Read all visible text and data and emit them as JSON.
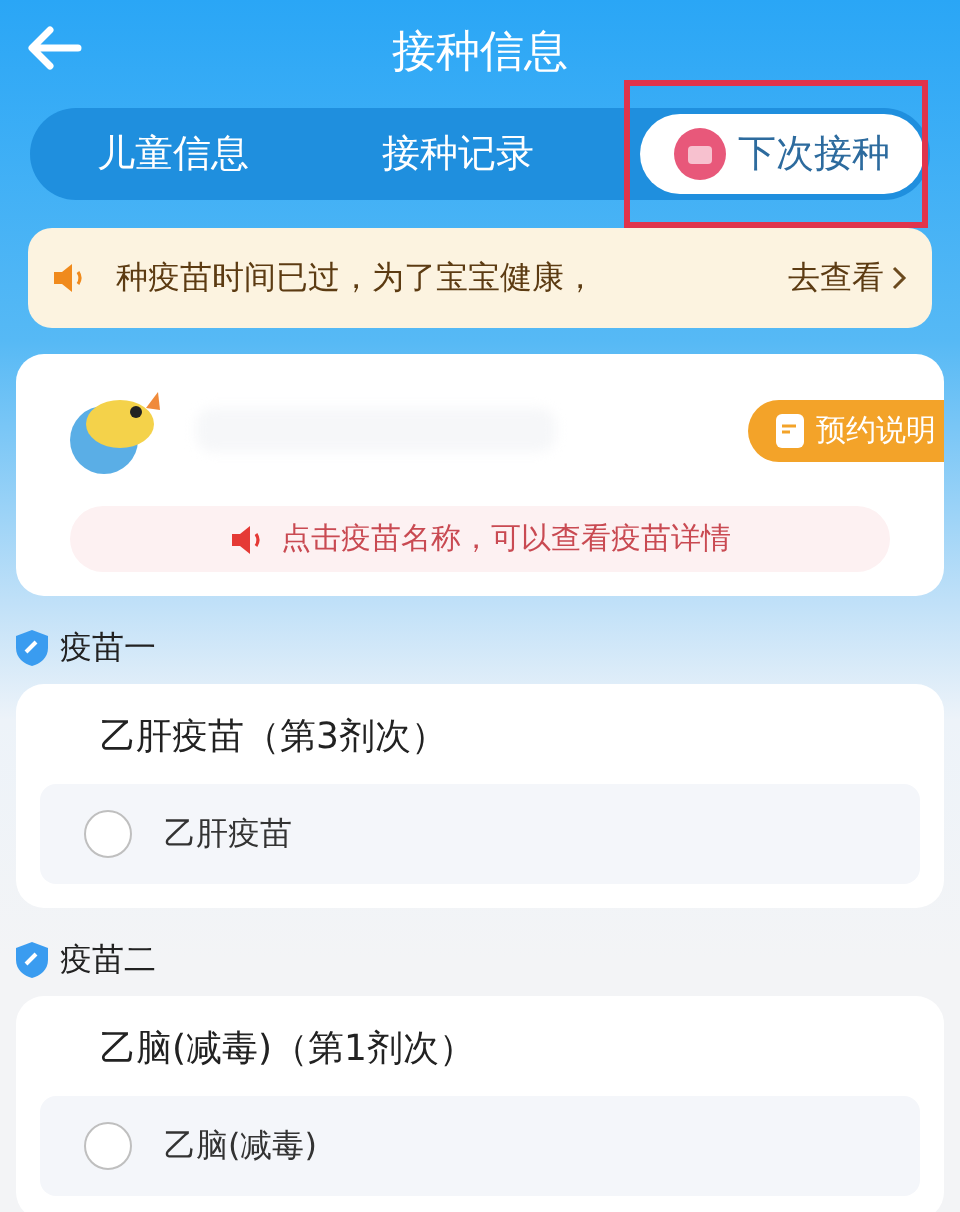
{
  "header": {
    "title": "接种信息"
  },
  "tabs": [
    {
      "label": "儿童信息",
      "selected": false,
      "highlighted": false
    },
    {
      "label": "接种记录",
      "selected": false,
      "highlighted": false
    },
    {
      "label": "下次接种",
      "selected": true,
      "highlighted": true
    }
  ],
  "notice": {
    "text": "种疫苗时间已过，为了宝宝健康，",
    "link": "去查看"
  },
  "profile": {
    "badge": "预约说明",
    "hint": "点击疫苗名称，可以查看疫苗详情"
  },
  "vaccines": [
    {
      "section": "疫苗一",
      "title": "乙肝疫苗（第3剂次）",
      "options": [
        {
          "label": "乙肝疫苗",
          "checked": false
        }
      ]
    },
    {
      "section": "疫苗二",
      "title": "乙脑(减毒)（第1剂次）",
      "options": [
        {
          "label": "乙脑(减毒)",
          "checked": false
        }
      ]
    }
  ]
}
